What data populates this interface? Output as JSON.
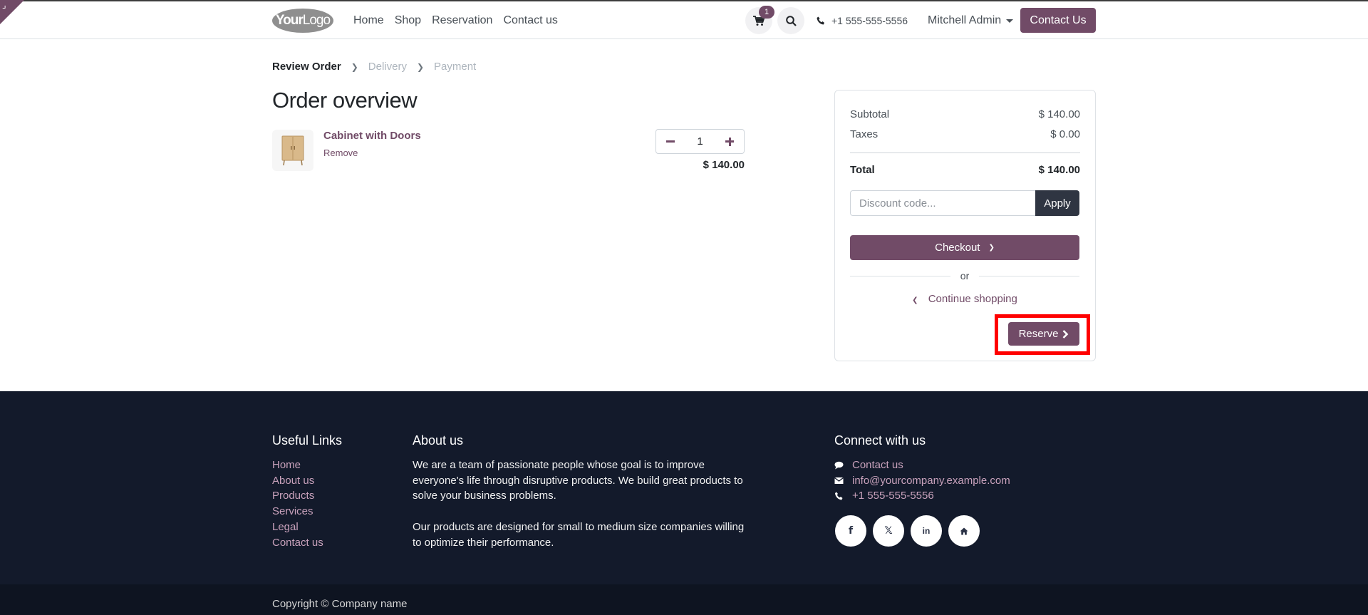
{
  "header": {
    "logo_bold": "Your",
    "logo_rest": "Logo",
    "nav": [
      "Home",
      "Shop",
      "Reservation",
      "Contact us"
    ],
    "cart_count": "1",
    "phone": "+1 555-555-5556",
    "user": "Mitchell Admin",
    "contact_button": "Contact Us"
  },
  "steps": {
    "review": "Review Order",
    "delivery": "Delivery",
    "payment": "Payment"
  },
  "main": {
    "title": "Order overview",
    "product": {
      "name": "Cabinet with Doors",
      "remove": "Remove",
      "quantity": "1",
      "price": "$ 140.00"
    }
  },
  "summary": {
    "subtotal_label": "Subtotal",
    "subtotal_value": "$ 140.00",
    "taxes_label": "Taxes",
    "taxes_value": "$ 0.00",
    "total_label": "Total",
    "total_value": "$ 140.00",
    "discount_placeholder": "Discount code...",
    "apply_label": "Apply",
    "checkout_label": "Checkout",
    "or_label": "or",
    "continue_label": "Continue shopping",
    "reserve_label": "Reserve"
  },
  "footer": {
    "useful_links_title": "Useful Links",
    "useful_links": [
      "Home",
      "About us",
      "Products",
      "Services",
      "Legal",
      "Contact us"
    ],
    "about_title": "About us",
    "about_p1": "We are a team of passionate people whose goal is to improve everyone's life through disruptive products. We build great products to solve your business problems.",
    "about_p2": "Our products are designed for small to medium size companies willing to optimize their performance.",
    "connect_title": "Connect with us",
    "contact_link": "Contact us",
    "email": "info@yourcompany.example.com",
    "phone": "+1 555-555-5556",
    "socials": [
      "facebook-icon",
      "x-icon",
      "linkedin-icon",
      "home-icon"
    ],
    "copyright": "Copyright © Company name"
  },
  "colors": {
    "brand": "#714B67",
    "footer_bg": "#131a2b",
    "highlight": "#ff0000"
  }
}
